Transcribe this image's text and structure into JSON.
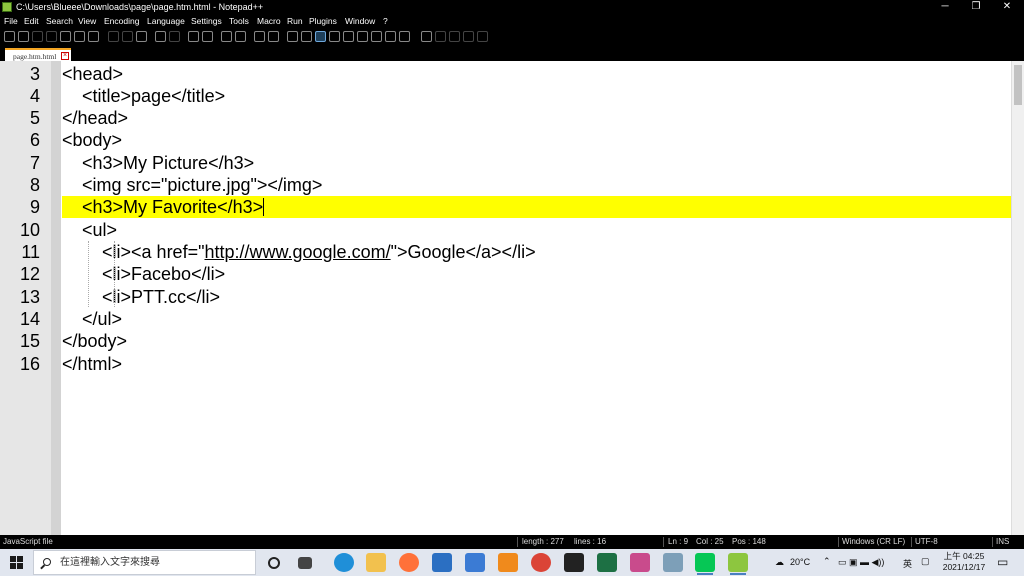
{
  "titlebar": {
    "title": "C:\\Users\\Blueee\\Downloads\\page\\page.htm.html - Notepad++",
    "minimize": "─",
    "restore": "❐",
    "close": "✕"
  },
  "menu": [
    "File",
    "Edit",
    "Search",
    "View",
    "Encoding",
    "Language",
    "Settings",
    "Tools",
    "Macro",
    "Run",
    "Plugins",
    "Window",
    "?"
  ],
  "tab": {
    "label": "page.htm.html",
    "close": "×"
  },
  "editor": {
    "lines": [
      {
        "num": "3",
        "text": "<head>"
      },
      {
        "num": "4",
        "text": "    <title>page</title>"
      },
      {
        "num": "5",
        "text": "</head>"
      },
      {
        "num": "6",
        "text": "<body>"
      },
      {
        "num": "7",
        "text": "    <h3>My Picture</h3>"
      },
      {
        "num": "8",
        "text": "    <img src=\"picture.jpg\"></img>"
      },
      {
        "num": "9",
        "text": "    <h3>My Favorite</h3>"
      },
      {
        "num": "10",
        "text": "    <ul>"
      },
      {
        "num": "11",
        "pre": "        <li><a href=\"",
        "url": "http://www.google.com/",
        "post": "\">Google</a></li>"
      },
      {
        "num": "12",
        "text": "        <li>Facebo</li>"
      },
      {
        "num": "13",
        "text": "        <li>PTT.cc</li>"
      },
      {
        "num": "14",
        "text": "    </ul>"
      },
      {
        "num": "15",
        "text": "</body>"
      },
      {
        "num": "16",
        "text": "</html>"
      }
    ],
    "current_line_color": "#ffff00"
  },
  "status": {
    "file_type": "JavaScript file",
    "length": "length : 277",
    "lines": "lines : 16",
    "ln": "Ln : 9",
    "col": "Col : 25",
    "pos": "Pos : 148",
    "eol": "Windows (CR LF)",
    "encoding": "UTF-8",
    "mode": "INS"
  },
  "taskbar": {
    "search_placeholder": "在這裡輸入文字來搜尋",
    "weather": "20°C",
    "ime": "英",
    "time": "上午 04:25",
    "date": "2021/12/17",
    "apps": [
      {
        "name": "task-view",
        "color": "#e1e6ef"
      },
      {
        "name": "widgets",
        "color": "#e1e6ef"
      },
      {
        "name": "edge",
        "color": "#1f8fd8"
      },
      {
        "name": "file-explorer",
        "color": "#f2c14e"
      },
      {
        "name": "firefox",
        "color": "#ff7139"
      },
      {
        "name": "mail",
        "color": "#2b6fc2"
      },
      {
        "name": "store",
        "color": "#3b7bd4"
      },
      {
        "name": "vlc",
        "color": "#f08a1c"
      },
      {
        "name": "chrome",
        "color": "#db4437"
      },
      {
        "name": "terminal",
        "color": "#222222"
      },
      {
        "name": "excel",
        "color": "#1d7044"
      },
      {
        "name": "paint",
        "color": "#c94b8c"
      },
      {
        "name": "visio",
        "color": "#7d9fb8"
      },
      {
        "name": "line",
        "color": "#06c755"
      },
      {
        "name": "notepad-plus-plus",
        "color": "#8dc63f"
      }
    ]
  }
}
